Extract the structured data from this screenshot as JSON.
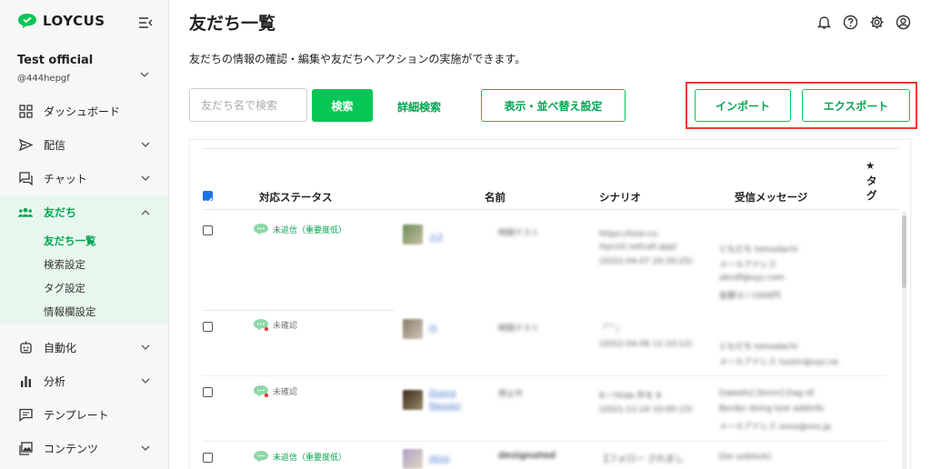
{
  "brand": {
    "name": "LOYCUS"
  },
  "account": {
    "name": "Test official",
    "id": "@444hepgf"
  },
  "nav": {
    "dashboard": "ダッシュボード",
    "delivery": "配信",
    "chat": "チャット",
    "friends": "友だち",
    "friends_sub": [
      "友だち一覧",
      "検索設定",
      "タグ設定",
      "情報欄設定"
    ],
    "automation": "自動化",
    "analytics": "分析",
    "templates": "テンプレート",
    "contents": "コンテンツ"
  },
  "page": {
    "title": "友だち一覧",
    "description": "友だちの情報の確認・編集や友だちへアクションの実施ができます。"
  },
  "toolbar": {
    "search_placeholder": "友だち名で検索",
    "search_label": "検索",
    "detail_search_label": "詳細検索",
    "display_settings_label": "表示・並べ替え設定",
    "import_label": "インポート",
    "export_label": "エクスポート"
  },
  "table": {
    "headers": {
      "status": "対応ステータス",
      "name": "名前",
      "scenario": "シナリオ",
      "message": "受信メッセージ",
      "star": "★",
      "tag_1": "タ",
      "tag_2": "グ"
    },
    "rows": [
      {
        "status": "未返信（重要度低）",
        "name": "ｎ3",
        "scenario_label": "時間テスト",
        "scenario": "https://test-co-loyco2.netcall.app/",
        "date": "(2022-04-07 20:30:25)",
        "msg1": "ともだち tomodachi",
        "msg2": "メールアドレス",
        "msg3": "abcdf@xyz.com",
        "msg4": "金額:0 / 1000円"
      },
      {
        "status": "未確認",
        "name": "m",
        "scenario_label": "時間テスト",
        "scenario": "「〝〞」",
        "date": "(2022-04-06 11:10:12)",
        "msg1": "ともだち tomodachi",
        "msg2": "メールアドレス tuzzin@xyz.ne"
      },
      {
        "status": "未確認",
        "name": "Duena Nauuen",
        "scenario_label": "停止中",
        "scenario": "8ー!thde 件を 8",
        "date": "(2021-12-24 10:00:15)",
        "msg1": "[sweets] [bnnn] [tag d]",
        "msg2": "Border doing test addinfo",
        "msg3": "メールアドレス xxxx@xxx.jp"
      },
      {
        "status": "未返信（重要度低）",
        "name": "ekiro",
        "scenario_label": "designated",
        "scenario": "【フォロー されまし",
        "msg1": "[tie unblock]"
      }
    ]
  },
  "colors": {
    "accent": "#06c755",
    "accent_text": "#06a552",
    "highlight": "#e53e2a"
  }
}
